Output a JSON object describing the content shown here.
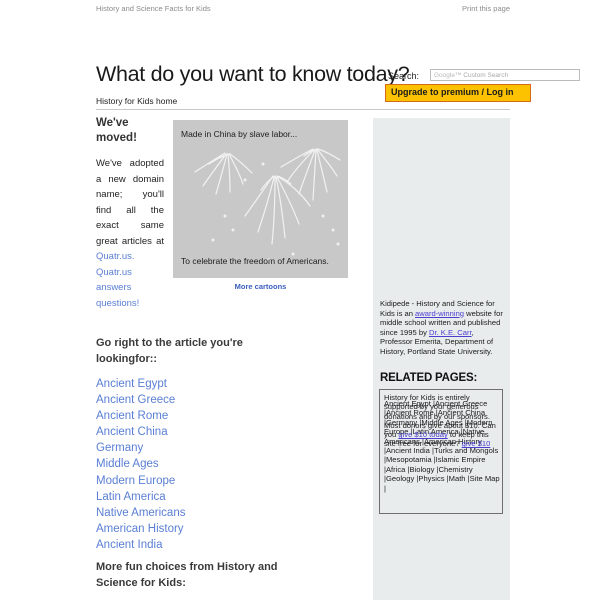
{
  "topbar": {
    "site_tagline": "History and Science Facts for Kids",
    "print_link": "Print this page"
  },
  "masthead": {
    "title": "What do you want to know today?",
    "search_label": "Search:",
    "search_value": "",
    "search_placeholder_brand": "Google™",
    "search_placeholder_text": "Custom Search",
    "upgrade_button": "Upgrade to premium / Log in"
  },
  "nav": {
    "home_link": "History for Kids home"
  },
  "left": {
    "moved_heading": "We've moved!",
    "moved_body_1": "We've adopted a new domain name; you'll find all the exact same great articles at ",
    "moved_link_1": "Quatr.us.",
    "moved_link_2": "Quatr.us answers questions!",
    "go_right_heading": "Go right to the article you're lookingfor::",
    "more_fun_heading": "More fun choices from History and Science for Kids:",
    "article_links": [
      "Ancient Egypt",
      "Ancient Greece",
      "Ancient Rome",
      "Ancient China",
      "Germany",
      "Middle Ages",
      "Modern Europe",
      "Latin America",
      "Native Americans",
      "American History",
      "Ancient India"
    ]
  },
  "cartoon": {
    "caption_top": "Made in China by slave labor...",
    "caption_bottom": "To celebrate the freedom of Americans.",
    "more_link": "More cartoons"
  },
  "sidebar": {
    "about_1": "Kidipede - History and Science for Kids is an ",
    "about_link_1": "award-winning",
    "about_2": " website for middle school written and published since 1995 by ",
    "about_link_2": "Dr. K.E. Carr",
    "about_3": ", Professor Emerita, Department of History, Portland State University.",
    "related_heading": "RELATED PAGES:",
    "donate_1": "History for Kids is entirely supported by your generous donations and by our sponsors. Most donors give about $10. Can you ",
    "donate_link_1": "give $10 today",
    "donate_2": " to keep this site free for everyone? ",
    "donate_link_2": "give $10",
    "related_links": [
      "Ancient Egypt",
      "Ancient Greece",
      "Ancient Rome",
      "Ancient China",
      "Germany",
      "Middle Ages",
      "Modern Europe",
      "Latin America",
      "Native Americans",
      "American History",
      "Ancient India",
      "Turks and Mongols",
      "Mesopotamia",
      "Islamic Empire",
      "Africa",
      "Biology",
      "Chemistry",
      "Geology",
      "Physics",
      "Math",
      "Site Map"
    ]
  },
  "colors": {
    "link": "#5a7fd4",
    "accent_orange": "#fcc200",
    "cartoon_bg": "#c8c8c8",
    "sidebar_bg": "#e8ecec"
  }
}
